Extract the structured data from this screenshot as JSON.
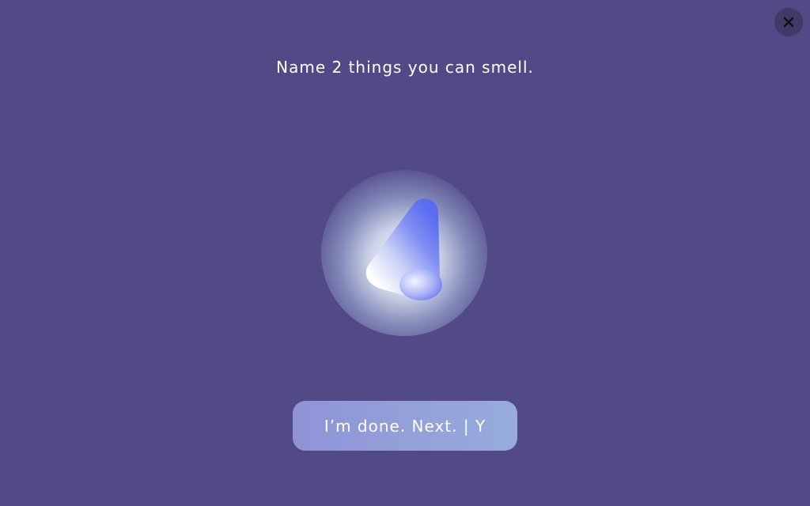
{
  "close_button": {
    "label": "X",
    "icon": "close-icon"
  },
  "prompt": {
    "text": "Name 2 things you can smell."
  },
  "illustration": {
    "icon": "nose-icon"
  },
  "next_button": {
    "label": "I’m done. Next. | Y"
  },
  "colors": {
    "background": "#524a87",
    "close_bg": "#3f3a66",
    "button_start": "#8f93d6",
    "button_end": "#97acdc",
    "nose_blue": "#5b6cf0",
    "text": "#ffffff"
  }
}
